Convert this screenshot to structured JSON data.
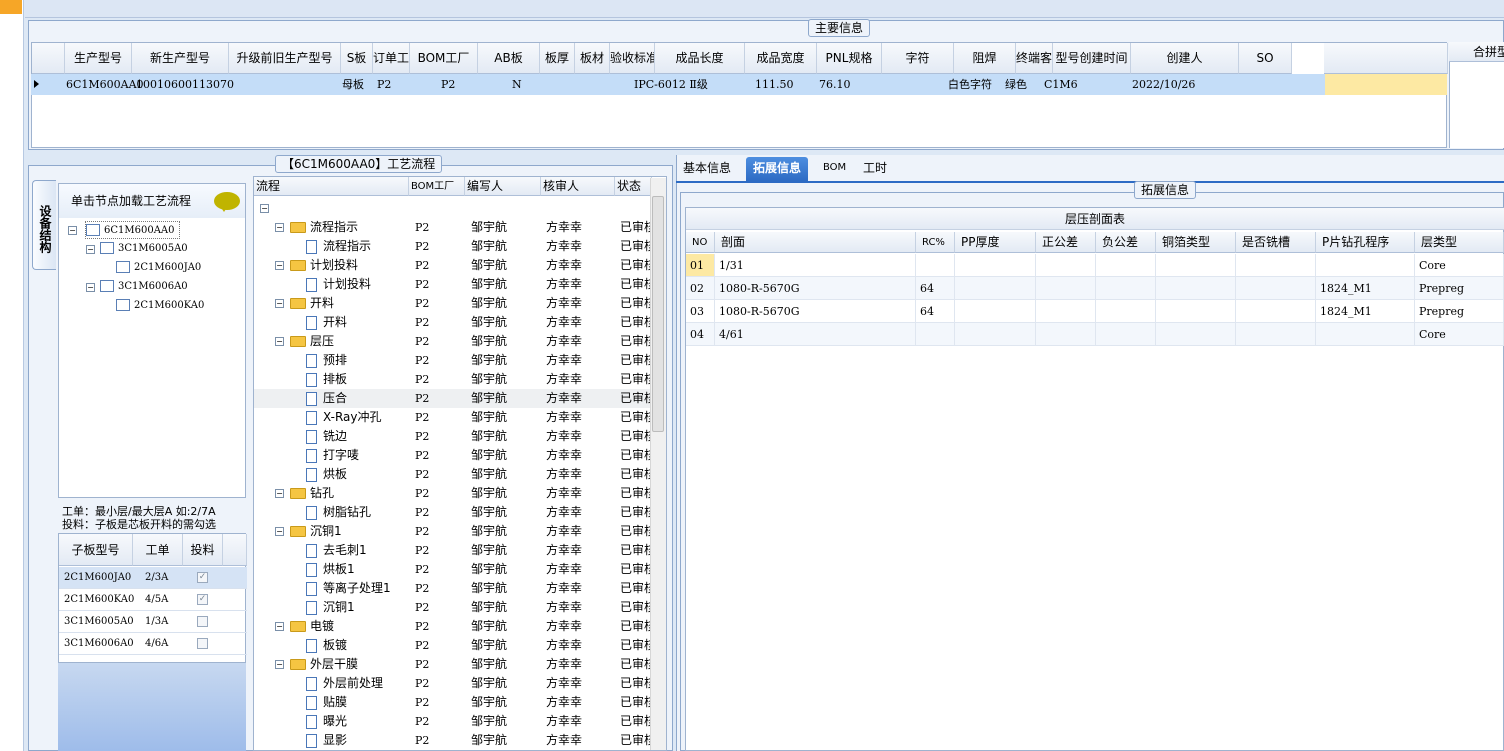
{
  "main_info": {
    "legend": "主要信息",
    "columns": [
      "生产型号",
      "新生产型号",
      "升级前旧生产型号",
      "S板",
      "订单工厂",
      "BOM工厂",
      "AB板",
      "板厚",
      "板材",
      "验收标准",
      "成品长度",
      "成品宽度",
      "PNL规格",
      "字符",
      "阻焊",
      "终端客户代码",
      "型号创建时间",
      "创建人",
      "SO"
    ],
    "row": [
      "6C1M600AA0",
      "10010600113070",
      "",
      "母板",
      "P2",
      "P2",
      "N",
      "",
      "",
      "IPC-6012 Ⅱ级",
      "111.50",
      "76.10",
      "",
      "白色字符",
      "绿色",
      "C1M6",
      "2022/10/26",
      "",
      ""
    ],
    "side_header": "合拼型"
  },
  "flow_panel": {
    "legend": "【6C1M600AA0】工艺流程",
    "vertical_tab": "设备结构",
    "tree_header": "单击节点加载工艺流程",
    "tree": [
      {
        "label": "6C1M600AA0",
        "level": 0
      },
      {
        "label": "3C1M6005A0",
        "level": 1
      },
      {
        "label": "2C1M600JA0",
        "level": 2
      },
      {
        "label": "3C1M6006A0",
        "level": 1
      },
      {
        "label": "2C1M600KA0",
        "level": 2
      }
    ],
    "note_line1": "工单：最小层/最大层A 如:2/7A",
    "note_line2": "投料：子板是芯板开料的需勾选",
    "sub_columns": [
      "子板型号",
      "工单",
      "投料"
    ],
    "sub_rows": [
      {
        "model": "2C1M600JA0",
        "order": "2/3A",
        "checked": true
      },
      {
        "model": "2C1M600KA0",
        "order": "4/5A",
        "checked": true
      },
      {
        "model": "3C1M6005A0",
        "order": "1/3A",
        "checked": false
      },
      {
        "model": "3C1M6006A0",
        "order": "4/6A",
        "checked": false
      }
    ]
  },
  "flow_grid": {
    "columns": [
      "流程",
      "BOM工厂",
      "编写人",
      "核审人",
      "状态"
    ],
    "root": "6C1M600AA0",
    "rows": [
      {
        "name": "流程指示",
        "type": "folder",
        "factory": "P2",
        "writer": "邹宇航",
        "reviewer": "方幸幸",
        "status": "已审核"
      },
      {
        "name": "流程指示",
        "type": "doc",
        "factory": "P2",
        "writer": "邹宇航",
        "reviewer": "方幸幸",
        "status": "已审核"
      },
      {
        "name": "计划投料",
        "type": "folder",
        "factory": "P2",
        "writer": "邹宇航",
        "reviewer": "方幸幸",
        "status": "已审核"
      },
      {
        "name": "计划投料",
        "type": "doc",
        "factory": "P2",
        "writer": "邹宇航",
        "reviewer": "方幸幸",
        "status": "已审核"
      },
      {
        "name": "开料",
        "type": "folder",
        "factory": "P2",
        "writer": "邹宇航",
        "reviewer": "方幸幸",
        "status": "已审核"
      },
      {
        "name": "开料",
        "type": "doc",
        "factory": "P2",
        "writer": "邹宇航",
        "reviewer": "方幸幸",
        "status": "已审核"
      },
      {
        "name": "层压",
        "type": "folder",
        "factory": "P2",
        "writer": "邹宇航",
        "reviewer": "方幸幸",
        "status": "已审核"
      },
      {
        "name": "预排",
        "type": "doc",
        "factory": "P2",
        "writer": "邹宇航",
        "reviewer": "方幸幸",
        "status": "已审核"
      },
      {
        "name": "排板",
        "type": "doc",
        "factory": "P2",
        "writer": "邹宇航",
        "reviewer": "方幸幸",
        "status": "已审核"
      },
      {
        "name": "压合",
        "type": "doc",
        "factory": "P2",
        "writer": "邹宇航",
        "reviewer": "方幸幸",
        "status": "已审核",
        "selected": true
      },
      {
        "name": "X-Ray冲孔",
        "type": "doc",
        "factory": "P2",
        "writer": "邹宇航",
        "reviewer": "方幸幸",
        "status": "已审核"
      },
      {
        "name": "铣边",
        "type": "doc",
        "factory": "P2",
        "writer": "邹宇航",
        "reviewer": "方幸幸",
        "status": "已审核"
      },
      {
        "name": "打字唛",
        "type": "doc",
        "factory": "P2",
        "writer": "邹宇航",
        "reviewer": "方幸幸",
        "status": "已审核"
      },
      {
        "name": "烘板",
        "type": "doc",
        "factory": "P2",
        "writer": "邹宇航",
        "reviewer": "方幸幸",
        "status": "已审核"
      },
      {
        "name": "钻孔",
        "type": "folder",
        "factory": "P2",
        "writer": "邹宇航",
        "reviewer": "方幸幸",
        "status": "已审核"
      },
      {
        "name": "树脂钻孔",
        "type": "doc",
        "factory": "P2",
        "writer": "邹宇航",
        "reviewer": "方幸幸",
        "status": "已审核"
      },
      {
        "name": "沉铜1",
        "type": "folder",
        "factory": "P2",
        "writer": "邹宇航",
        "reviewer": "方幸幸",
        "status": "已审核"
      },
      {
        "name": "去毛刺1",
        "type": "doc",
        "factory": "P2",
        "writer": "邹宇航",
        "reviewer": "方幸幸",
        "status": "已审核"
      },
      {
        "name": "烘板1",
        "type": "doc",
        "factory": "P2",
        "writer": "邹宇航",
        "reviewer": "方幸幸",
        "status": "已审核"
      },
      {
        "name": "等离子处理1",
        "type": "doc",
        "factory": "P2",
        "writer": "邹宇航",
        "reviewer": "方幸幸",
        "status": "已审核"
      },
      {
        "name": "沉铜1",
        "type": "doc",
        "factory": "P2",
        "writer": "邹宇航",
        "reviewer": "方幸幸",
        "status": "已审核"
      },
      {
        "name": "电镀",
        "type": "folder",
        "factory": "P2",
        "writer": "邹宇航",
        "reviewer": "方幸幸",
        "status": "已审核"
      },
      {
        "name": "板镀",
        "type": "doc",
        "factory": "P2",
        "writer": "邹宇航",
        "reviewer": "方幸幸",
        "status": "已审核"
      },
      {
        "name": "外层干膜",
        "type": "folder",
        "factory": "P2",
        "writer": "邹宇航",
        "reviewer": "方幸幸",
        "status": "已审核"
      },
      {
        "name": "外层前处理",
        "type": "doc",
        "factory": "P2",
        "writer": "邹宇航",
        "reviewer": "方幸幸",
        "status": "已审核"
      },
      {
        "name": "贴膜",
        "type": "doc",
        "factory": "P2",
        "writer": "邹宇航",
        "reviewer": "方幸幸",
        "status": "已审核"
      },
      {
        "name": "曝光",
        "type": "doc",
        "factory": "P2",
        "writer": "邹宇航",
        "reviewer": "方幸幸",
        "status": "已审核"
      },
      {
        "name": "显影",
        "type": "doc",
        "factory": "P2",
        "writer": "邹宇航",
        "reviewer": "方幸幸",
        "status": "已审核"
      }
    ]
  },
  "right_panel": {
    "tabs": [
      "基本信息",
      "拓展信息",
      "BOM",
      "工时"
    ],
    "active_tab": "拓展信息",
    "ext_legend": "拓展信息",
    "table_title": "层压剖面表",
    "columns": [
      "NO",
      "剖面",
      "RC%",
      "PP厚度",
      "正公差",
      "负公差",
      "铜箔类型",
      "是否铣槽",
      "P片钻孔程序",
      "层类型"
    ],
    "rows": [
      [
        "01",
        "1/31",
        "",
        "",
        "",
        "",
        "",
        "",
        "",
        "Core"
      ],
      [
        "02",
        "1080-R-5670G",
        "64",
        "",
        "",
        "",
        "",
        "",
        "1824_M1",
        "Prepreg"
      ],
      [
        "03",
        "1080-R-5670G",
        "64",
        "",
        "",
        "",
        "",
        "",
        "1824_M1",
        "Prepreg"
      ],
      [
        "04",
        "4/61",
        "",
        "",
        "",
        "",
        "",
        "",
        "",
        "Core"
      ]
    ]
  }
}
